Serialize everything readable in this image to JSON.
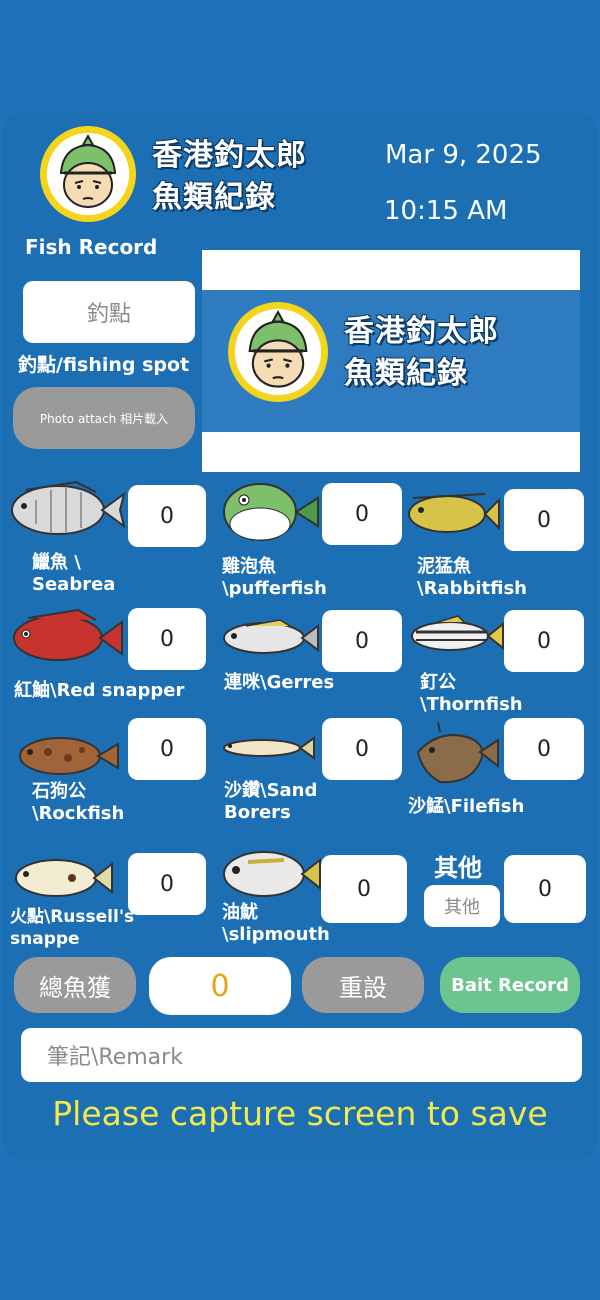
{
  "header": {
    "logo_title_line1": "香港釣太郎",
    "logo_title_line2": "魚類紀錄",
    "date": "Mar 9, 2025",
    "time": "10:15 AM",
    "subtitle": "Fish Record"
  },
  "spot": {
    "placeholder": "釣點",
    "label": "釣點/fishing spot"
  },
  "photo_button": "Photo attach 相片載入",
  "banner": {
    "title_line1": "香港釣太郎",
    "title_line2": "魚類紀錄"
  },
  "fish": [
    {
      "label": "鱲魚 \\ Seabrea",
      "count": "0",
      "icon": "seabream-icon"
    },
    {
      "label": "雞泡魚 \\pufferfish",
      "count": "0",
      "icon": "pufferfish-icon"
    },
    {
      "label": "泥猛魚 \\Rabbitfish",
      "count": "0",
      "icon": "rabbitfish-icon"
    },
    {
      "label": "紅鮋\\Red snapper",
      "count": "0",
      "icon": "red-snapper-icon"
    },
    {
      "label": "連咪\\Gerres",
      "count": "0",
      "icon": "gerres-icon"
    },
    {
      "label": "釘公 \\Thornfish",
      "count": "0",
      "icon": "thornfish-icon"
    },
    {
      "label": "石狗公 \\Rockfish",
      "count": "0",
      "icon": "rockfish-icon"
    },
    {
      "label": "沙鑽\\Sand Borers",
      "count": "0",
      "icon": "sand-borer-icon"
    },
    {
      "label": "沙鯭\\Filefish",
      "count": "0",
      "icon": "filefish-icon"
    },
    {
      "label": "火點\\Russell's snappe",
      "count": "0",
      "icon": "russells-snapper-icon"
    },
    {
      "label": "油魷 \\slipmouth",
      "count": "0",
      "icon": "slipmouth-icon"
    }
  ],
  "other": {
    "heading": "其他",
    "placeholder": "其他",
    "count": "0"
  },
  "actions": {
    "total_label": "總魚獲",
    "total_value": "0",
    "reset_label": "重設",
    "bait_label": "Bait Record"
  },
  "remark": {
    "placeholder": "筆記\\Remark"
  },
  "save_message": "Please capture screen to save"
}
